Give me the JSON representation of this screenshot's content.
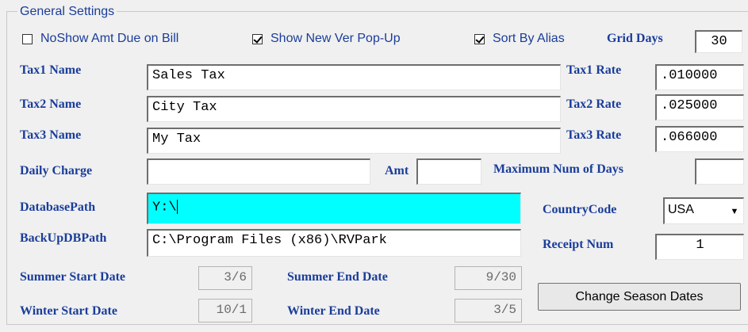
{
  "group": {
    "title": "General Settings"
  },
  "checkboxes": [
    {
      "label": "NoShow Amt Due on Bill",
      "checked": false
    },
    {
      "label": "Show New Ver Pop-Up",
      "checked": true
    },
    {
      "label": "Sort By Alias",
      "checked": true
    }
  ],
  "grid_days": {
    "label": "Grid Days",
    "value": "30"
  },
  "taxes": [
    {
      "name_label": "Tax1 Name",
      "name": "Sales Tax",
      "rate_label": "Tax1 Rate",
      "rate": ".010000"
    },
    {
      "name_label": "Tax2 Name",
      "name": "City Tax",
      "rate_label": "Tax2 Rate",
      "rate": ".025000"
    },
    {
      "name_label": "Tax3 Name",
      "name": "My Tax",
      "rate_label": "Tax3 Rate",
      "rate": ".066000"
    }
  ],
  "daily_charge": {
    "label": "Daily Charge",
    "value": "",
    "amt_label": "Amt",
    "amt": "",
    "max_days_label": "Maximum Num of Days",
    "max_days": ""
  },
  "database_path": {
    "label": "DatabasePath",
    "value": "Y:\\"
  },
  "backup_path": {
    "label": "BackUpDBPath",
    "value": "C:\\Program Files (x86)\\RVPark"
  },
  "country_code": {
    "label": "CountryCode",
    "value": "USA"
  },
  "receipt_num": {
    "label": "Receipt Num",
    "value": "1"
  },
  "seasons": {
    "summer_start_label": "Summer Start Date",
    "summer_start": "3/6",
    "summer_end_label": "Summer End Date",
    "summer_end": "9/30",
    "winter_start_label": "Winter Start Date",
    "winter_start": "10/1",
    "winter_end_label": "Winter End Date",
    "winter_end": "3/5"
  },
  "change_season_button": "Change Season Dates"
}
